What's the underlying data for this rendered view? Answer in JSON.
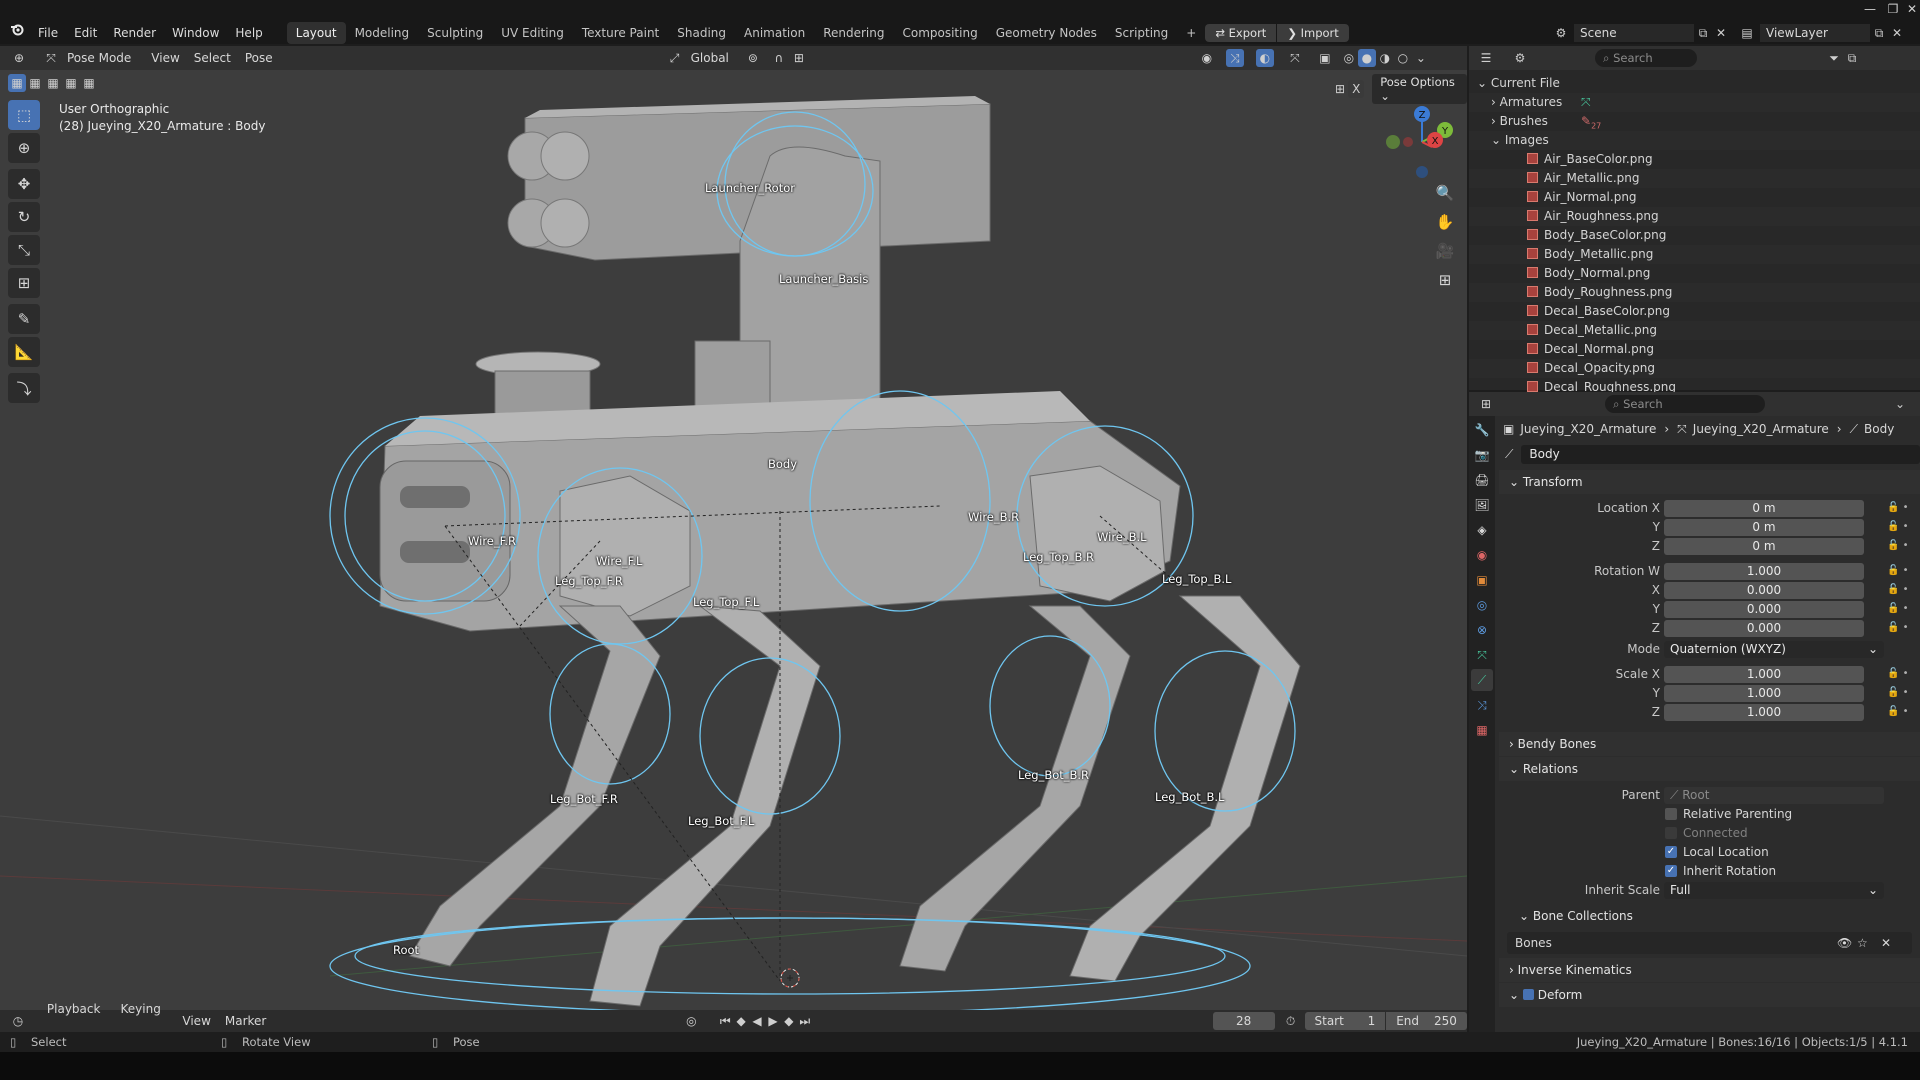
{
  "menubar": {
    "menus": [
      "File",
      "Edit",
      "Render",
      "Window",
      "Help"
    ],
    "workspaces": [
      "Layout",
      "Modeling",
      "Sculpting",
      "UV Editing",
      "Texture Paint",
      "Shading",
      "Animation",
      "Rendering",
      "Compositing",
      "Geometry Nodes",
      "Scripting"
    ],
    "active_workspace": "Layout",
    "export_label": "Export",
    "import_label": "Import",
    "scene_label": "Scene",
    "viewlayer_label": "ViewLayer"
  },
  "viewport": {
    "mode": "Pose Mode",
    "menus": [
      "View",
      "Select",
      "Pose"
    ],
    "orientation": "Global",
    "pose_options": "Pose Options",
    "view_name": "User Orthographic",
    "active_info": "(28) Jueying_X20_Armature : Body",
    "bones": [
      {
        "label": "Launcher_Rotor"
      },
      {
        "label": "Launcher_Basis"
      },
      {
        "label": "Body"
      },
      {
        "label": "Wire_F.R"
      },
      {
        "label": "Wire_F.L"
      },
      {
        "label": "Wire_B.R"
      },
      {
        "label": "Wire_B.L"
      },
      {
        "label": "Leg_Top_F.R"
      },
      {
        "label": "Leg_Top_F.L"
      },
      {
        "label": "Leg_Top_B.R"
      },
      {
        "label": "Leg_Top_B.L"
      },
      {
        "label": "Leg_Bot_F.R"
      },
      {
        "label": "Leg_Bot_F.L"
      },
      {
        "label": "Leg_Bot_B.R"
      },
      {
        "label": "Leg_Bot_B.L"
      },
      {
        "label": "Root"
      }
    ],
    "gizmo_axes": {
      "z": "Z",
      "y": "Y",
      "x": "X"
    }
  },
  "outliner": {
    "search_placeholder": "Search",
    "root": "Current File",
    "categories": [
      "Armatures",
      "Brushes",
      "Images"
    ],
    "brushes_count": "27",
    "images": [
      "Air_BaseColor.png",
      "Air_Metallic.png",
      "Air_Normal.png",
      "Air_Roughness.png",
      "Body_BaseColor.png",
      "Body_Metallic.png",
      "Body_Normal.png",
      "Body_Roughness.png",
      "Decal_BaseColor.png",
      "Decal_Metallic.png",
      "Decal_Normal.png",
      "Decal_Opacity.png",
      "Decal_Roughness.png"
    ]
  },
  "properties": {
    "search_placeholder": "Search",
    "breadcrumb": [
      "Jueying_X20_Armature",
      "Jueying_X20_Armature",
      "Body"
    ],
    "bone_name": "Body",
    "transform_title": "Transform",
    "location": {
      "label_x": "Location X",
      "label_y": "Y",
      "label_z": "Z",
      "x": "0 m",
      "y": "0 m",
      "z": "0 m"
    },
    "rotation": {
      "label_w": "Rotation W",
      "label_x": "X",
      "label_y": "Y",
      "label_z": "Z",
      "w": "1.000",
      "x": "0.000",
      "y": "0.000",
      "z": "0.000"
    },
    "mode_label": "Mode",
    "mode_value": "Quaternion (WXYZ)",
    "scale": {
      "label_x": "Scale X",
      "label_y": "Y",
      "label_z": "Z",
      "x": "1.000",
      "y": "1.000",
      "z": "1.000"
    },
    "bendy_bones": "Bendy Bones",
    "relations": "Relations",
    "parent_label": "Parent",
    "parent_value": "Root",
    "relative_parenting": "Relative Parenting",
    "connected": "Connected",
    "local_location": "Local Location",
    "inherit_rotation": "Inherit Rotation",
    "inherit_scale_label": "Inherit Scale",
    "inherit_scale_value": "Full",
    "bone_collections": "Bone Collections",
    "collection_name": "Bones",
    "inverse_kinematics": "Inverse Kinematics",
    "deform": "Deform"
  },
  "timeline": {
    "menus": [
      "Playback",
      "Keying",
      "View",
      "Marker"
    ],
    "current_frame": "28",
    "start_label": "Start",
    "start_value": "1",
    "end_label": "End",
    "end_value": "250"
  },
  "status": {
    "select": "Select",
    "rotate": "Rotate View",
    "pose": "Pose",
    "info": "Jueying_X20_Armature | Bones:16/16 | Objects:1/5 | 4.1.1"
  },
  "colors": {
    "accent": "#4772b3",
    "bone_wire": "#6fc6f0",
    "viewport_bg": "#3d3d3d"
  }
}
